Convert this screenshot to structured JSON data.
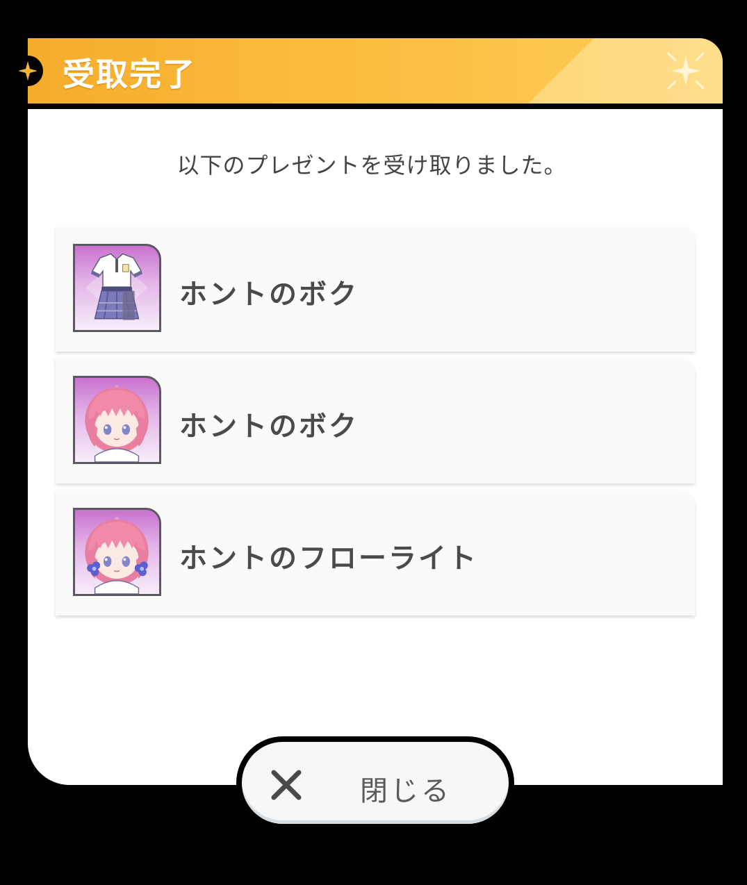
{
  "dialog": {
    "title": "受取完了",
    "message": "以下のプレゼントを受け取りました。"
  },
  "items": [
    {
      "name": "ホントのボク",
      "icon": "costume-icon"
    },
    {
      "name": "ホントのボク",
      "icon": "character-portrait-icon"
    },
    {
      "name": "ホントのフローライト",
      "icon": "character-hair-accessory-icon"
    }
  ],
  "close_button": {
    "label": "閉じる",
    "icon": "close-icon"
  },
  "colors": {
    "header": "#f6ac2c",
    "background": "#000000",
    "panel": "#ffffff",
    "text": "#444444"
  }
}
